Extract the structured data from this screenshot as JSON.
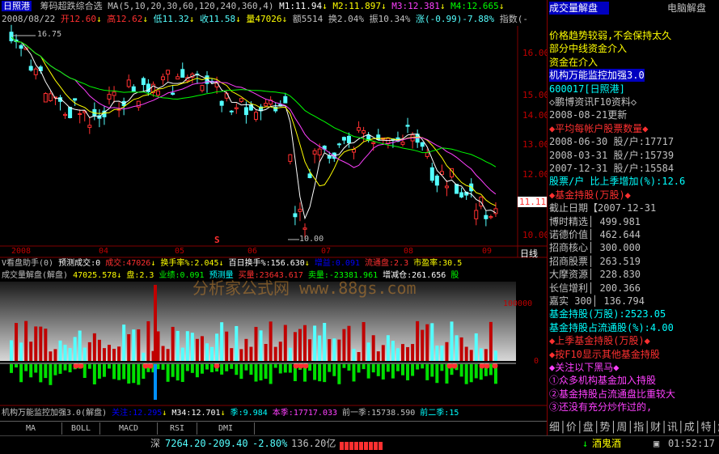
{
  "header": {
    "stock_name": "日照港",
    "indicator_line": "筹码超跌综合选 MA(5,10,20,30,60,120,240,360,4)",
    "m1": "M1:11.94",
    "m2": "M2:11.897",
    "m3": "M3:12.381",
    "m4": "M4:12.665",
    "date": "2008/08/22",
    "open": "开12.60",
    "high": "高12.62",
    "low": "低11.32",
    "close": "收11.58",
    "volume": "量47026",
    "amount": "额5514",
    "turnover": "换2.04%",
    "amplitude": "振10.34%",
    "change": "涨(-0.99)-7.88%",
    "index_label": "指数(-"
  },
  "price_axis": {
    "ticks": [
      "16.00",
      "15.00",
      "14.00",
      "13.00",
      "12.00",
      "11.00",
      "10.00"
    ],
    "current_price": "11.11",
    "hi_label": "16.75",
    "lo_label": "10.00",
    "mark": "S"
  },
  "time_axis": {
    "labels": [
      "2008",
      "04",
      "05",
      "06",
      "07",
      "08",
      "09"
    ],
    "period": "日线"
  },
  "sub1": {
    "line1_title": "V看盘助手(0)",
    "line1_pred": "预测成交:0",
    "line1_vol": "成交:47026",
    "line1_turn": "换手率%:2.045",
    "line1_100day": "百日换手%:156.630",
    "line1_big": "增益:0.091",
    "line1_flow": "流通盘:2.3",
    "line1_pe": "市盈率:30.5",
    "line2_title": "成交量解盘(解盘)",
    "line2_val": "47025.578",
    "line2_pan": "盘:2.3",
    "line2_perf": "业绩:0.091",
    "line2_pred": "预测量",
    "line2_buy": "买量:23643.617",
    "line2_sell": "卖量:-23381.961",
    "line2_gain": "增减仓:261.656",
    "line2_end": "股",
    "axis_100000": "100000",
    "axis_0": "0",
    "watermark": "分析家公式网 www.88gs.com"
  },
  "sub2": {
    "title": "机构万能监控加强3.0(解盘)",
    "attention": "关注:12.295",
    "m34": "M34:12.701",
    "quarter_sep": "季:9.984",
    "this_quarter": "本季:17717.033",
    "prev_quarter": "前一季:15738.590",
    "prev2_quarter": "前二季:15"
  },
  "tabs": [
    "MA",
    "BOLL",
    "MACD",
    "RSI",
    "DMI"
  ],
  "right_panel": {
    "title": "成交量解盘",
    "software": "电脑解盘",
    "lines": [
      {
        "text": "价格趋势较弱,不会保持太久",
        "color": "#ffff00"
      },
      {
        "text": "部分中线资金介入",
        "color": "#ffff00"
      },
      {
        "text": "资金在介入",
        "color": "#ffff00"
      },
      {
        "text": "机构万能监控加强3.0",
        "color": "#ffffff",
        "bg": "#0000c0"
      },
      {
        "text": "600017[日照港]",
        "color": "#00ffff"
      },
      {
        "text": "◇鹏博资讯F10资料◇",
        "color": "#c0c0c0"
      },
      {
        "text": "2008-08-21更新",
        "color": "#c0c0c0"
      },
      {
        "text": "◆平均每帐户股票数量◆",
        "color": "#ff3030"
      },
      {
        "text": "2008-06-30 股/户:17717",
        "color": "#c0c0c0"
      },
      {
        "text": "2008-03-31 股/户:15739",
        "color": "#c0c0c0"
      },
      {
        "text": "2007-12-31 股/户:15584",
        "color": "#c0c0c0"
      },
      {
        "text": "股票/户 比上季增加(%):12.6",
        "color": "#00ffff"
      },
      {
        "text": "◆基金持股(万股)◆",
        "color": "#ff3030"
      },
      {
        "text": "截止日期【2007-12-31",
        "color": "#c0c0c0"
      },
      {
        "text": "博时精选│ 499.981",
        "color": "#c0c0c0"
      },
      {
        "text": "诺德价值│ 462.644",
        "color": "#c0c0c0"
      },
      {
        "text": "招商核心│ 300.000",
        "color": "#c0c0c0"
      },
      {
        "text": "招商股票│ 263.519",
        "color": "#c0c0c0"
      },
      {
        "text": "大摩资源│ 228.830",
        "color": "#c0c0c0"
      },
      {
        "text": "长信增利│ 200.366",
        "color": "#c0c0c0"
      },
      {
        "text": "嘉实 300│ 136.794",
        "color": "#c0c0c0"
      },
      {
        "text": "基金持股(万股):2523.05",
        "color": "#00ffff"
      },
      {
        "text": "基金持股占流通股(%):4.00",
        "color": "#00ffff"
      },
      {
        "text": "◆上季基金持股(万股)◆",
        "color": "#ff3030"
      },
      {
        "text": "◆按F10显示其他基金持股",
        "color": "#ff3030"
      },
      {
        "text": "◆关注以下黑马◆",
        "color": "#ff40ff"
      },
      {
        "text": "①众多机构基金加入持股",
        "color": "#ff40ff"
      },
      {
        "text": "②基金持股占流通盘比重较大",
        "color": "#ff40ff"
      },
      {
        "text": "③还没有充分炒作过的,",
        "color": "#ff40ff"
      }
    ],
    "bottom_tabs": [
      "细",
      "价",
      "盘",
      "势",
      "周",
      "指",
      "财",
      "讯",
      "成",
      "特",
      "解"
    ]
  },
  "status": {
    "market": "深",
    "index": "7264.20",
    "change": "-209.40",
    "pct": "-2.80%",
    "amount": "136.20亿",
    "alert": "酒鬼酒",
    "time": "01:52:17"
  },
  "colors": {
    "up": "#ff3030",
    "down": "#54ffff",
    "ma5": "#ffffff",
    "ma10": "#ffff00",
    "ma20": "#ff40ff",
    "ma60": "#00ff00",
    "axis": "#c00000"
  }
}
